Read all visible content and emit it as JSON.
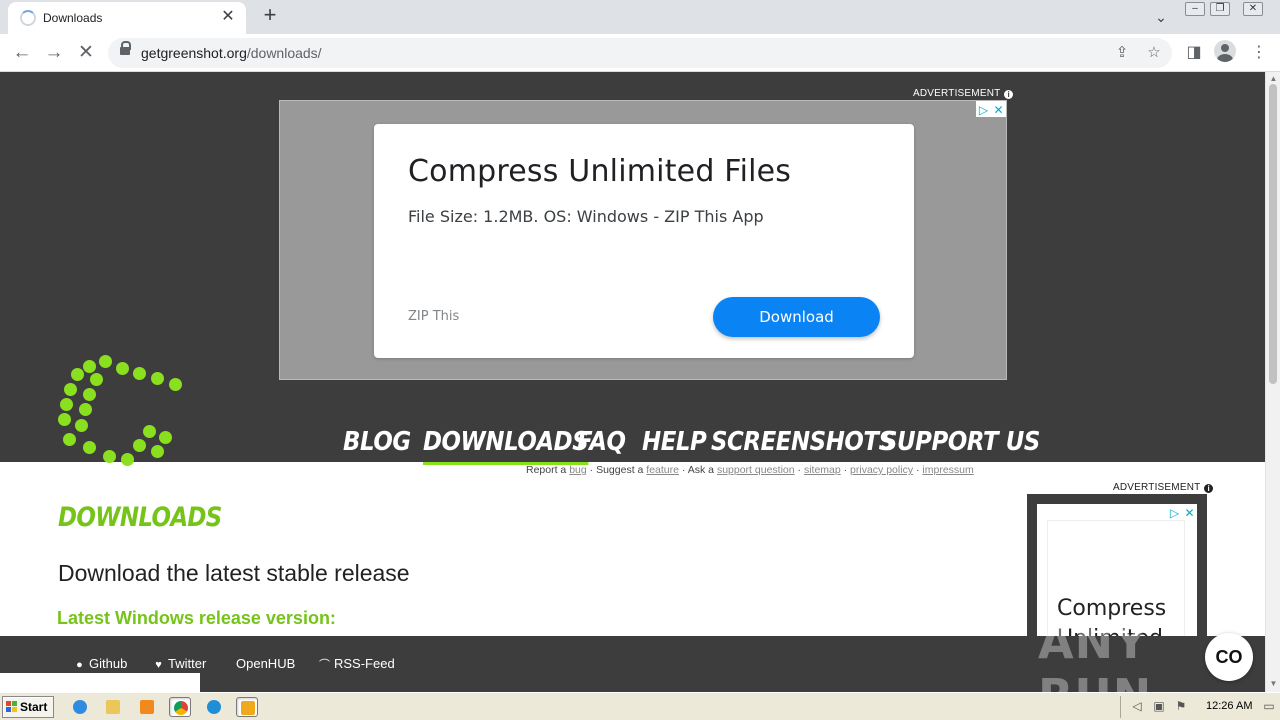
{
  "browser": {
    "tab_title": "Downloads",
    "url_host": "getgreenshot.org",
    "url_path": "/downloads/"
  },
  "ad_top": {
    "label": "ADVERTISEMENT",
    "headline": "Compress Unlimited Files",
    "description": "File Size: 1.2MB. OS: Windows - ZIP This App",
    "advertiser": "ZIP This",
    "cta": "Download"
  },
  "nav": {
    "items": [
      "BLOG",
      "DOWNLOADS",
      "FAQ",
      "HELP",
      "SCREENSHOTS",
      "SUPPORT US"
    ],
    "active": "DOWNLOADS"
  },
  "subnav": {
    "report_prefix": "Report a",
    "bug": "bug",
    "suggest_prefix": "Suggest a",
    "feature": "feature",
    "ask_prefix": "Ask a",
    "support_question": "support question",
    "sitemap": "sitemap",
    "privacy_policy": "privacy policy",
    "impressum": "impressum",
    "sep": "·"
  },
  "main": {
    "title": "DOWNLOADS",
    "heading": "Download the latest stable release",
    "subheading": "Latest Windows release version:"
  },
  "ad_side": {
    "label": "ADVERTISEMENT",
    "text": "Compress Unlimited"
  },
  "footer": {
    "links": [
      "Github",
      "Twitter",
      "OpenHUB",
      "RSS-Feed"
    ]
  },
  "watermark": "ANY RUN",
  "chat_label": "CO",
  "taskbar": {
    "start_label": "Start",
    "clock": "12:26 AM"
  },
  "colors": {
    "brand_green": "#8ae01f",
    "dark_bg": "#3d3d3d",
    "ad_button": "#0a84f5"
  }
}
